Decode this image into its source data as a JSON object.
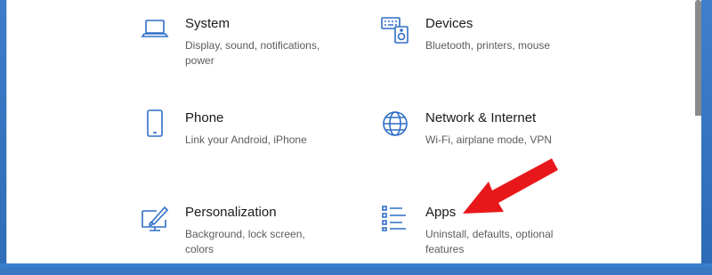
{
  "settings": {
    "tiles": [
      {
        "title": "System",
        "desc": "Display, sound, notifications, power",
        "icon": "laptop-icon"
      },
      {
        "title": "Devices",
        "desc": "Bluetooth, printers, mouse",
        "icon": "keyboard-speaker-icon"
      },
      {
        "title": "Phone",
        "desc": "Link your Android, iPhone",
        "icon": "phone-icon"
      },
      {
        "title": "Network & Internet",
        "desc": "Wi-Fi, airplane mode, VPN",
        "icon": "globe-icon"
      },
      {
        "title": "Personalization",
        "desc": "Background, lock screen, colors",
        "icon": "paintbrush-icon"
      },
      {
        "title": "Apps",
        "desc": "Uninstall, defaults, optional features",
        "icon": "apps-list-icon"
      }
    ]
  },
  "colors": {
    "accent": "#2f6ec6",
    "annotation_arrow": "#e8181a"
  }
}
